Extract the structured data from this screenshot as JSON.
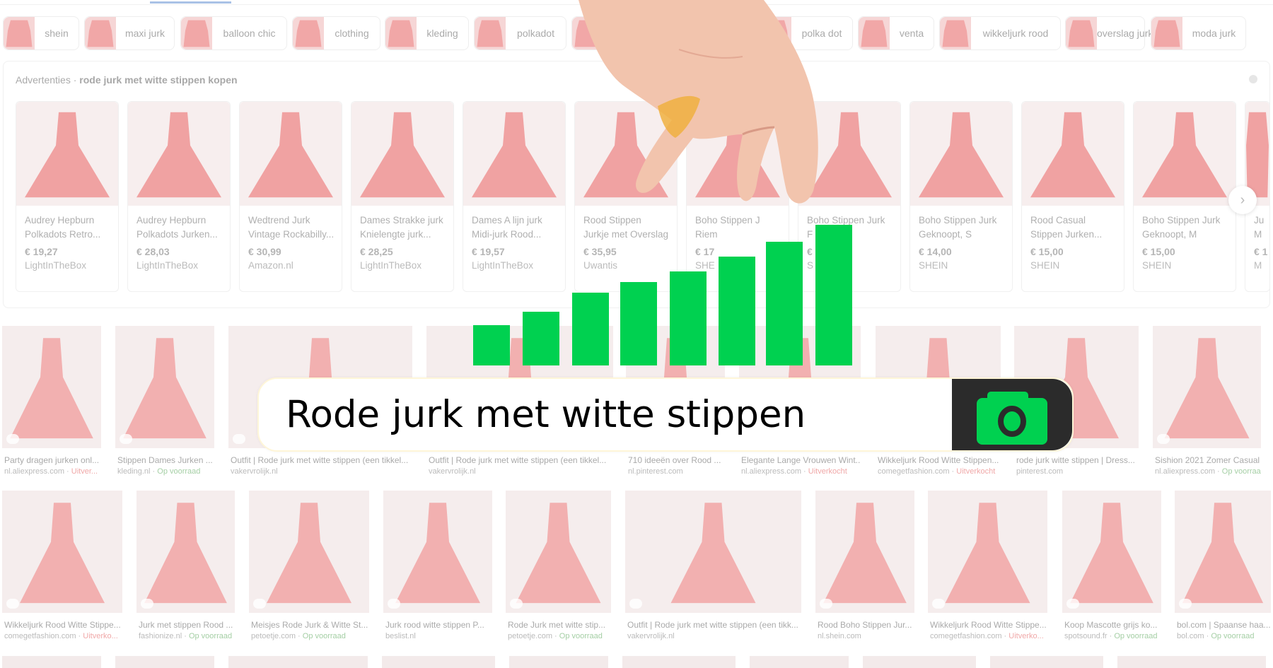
{
  "chips": [
    {
      "label": "shein"
    },
    {
      "label": "maxi jurk"
    },
    {
      "label": "balloon chic"
    },
    {
      "label": "clothing"
    },
    {
      "label": "kleding"
    },
    {
      "label": "polkadot"
    },
    {
      "label": ""
    },
    {
      "label": "polka dot"
    },
    {
      "label": "venta"
    },
    {
      "label": "wikkeljurk rood"
    },
    {
      "label": "overslag jurk"
    },
    {
      "label": "moda jurk"
    }
  ],
  "ads": {
    "label": "Advertenties",
    "separator": " · ",
    "query": "rode jurk met witte stippen kopen",
    "next_icon": "›",
    "items": [
      {
        "title1": "Audrey Hepburn",
        "title2": "Polkadots Retro...",
        "price": "€ 19,27",
        "store": "LightInTheBox"
      },
      {
        "title1": "Audrey Hepburn",
        "title2": "Polkadots Jurken...",
        "price": "€ 28,03",
        "store": "LightInTheBox"
      },
      {
        "title1": "Wedtrend Jurk",
        "title2": "Vintage Rockabilly...",
        "price": "€ 30,99",
        "store": "Amazon.nl"
      },
      {
        "title1": "Dames Strakke jurk",
        "title2": "Knielengte jurk...",
        "price": "€ 28,25",
        "store": "LightInTheBox"
      },
      {
        "title1": "Dames A lijn jurk",
        "title2": "Midi-jurk Rood...",
        "price": "€ 19,57",
        "store": "LightInTheBox"
      },
      {
        "title1": "Rood Stippen",
        "title2": "Jurkje met Overslag",
        "price": "€ 35,95",
        "store": "Uwantis"
      },
      {
        "title1": "Boho Stippen J",
        "title2": "Riem",
        "price": "€ 17",
        "store": "SHE"
      },
      {
        "title1": "Boho Stippen Jurk",
        "title2": "F",
        "price": "€",
        "store": "S"
      },
      {
        "title1": "Boho Stippen Jurk",
        "title2": "Geknoopt, S",
        "price": "€ 14,00",
        "store": "SHEIN"
      },
      {
        "title1": "Rood Casual",
        "title2": "Stippen Jurken...",
        "price": "€ 15,00",
        "store": "SHEIN"
      },
      {
        "title1": "Boho Stippen Jurk",
        "title2": "Geknoopt, M",
        "price": "€ 15,00",
        "store": "SHEIN"
      },
      {
        "title1": "Ju",
        "title2": "M",
        "price": "€ 1",
        "store": "M"
      }
    ]
  },
  "results": {
    "row1": [
      {
        "title": "Party dragen jurken onl...",
        "source": "nl.aliexpress.com",
        "status": "Uitver...",
        "status_type": "sold"
      },
      {
        "title": "Stippen Dames Jurken ...",
        "source": "kleding.nl",
        "status": "Op voorraad",
        "status_type": "stock"
      },
      {
        "title": "Outfit | Rode jurk met witte stippen (een tikkel...",
        "source": "vakervrolijk.nl",
        "status": "",
        "status_type": ""
      },
      {
        "title": "Outfit | Rode jurk met witte stippen (een tikkel...",
        "source": "vakervrolijk.nl",
        "status": "",
        "status_type": ""
      },
      {
        "title": "710 ideeën over Rood ...",
        "source": "nl.pinterest.com",
        "status": "",
        "status_type": ""
      },
      {
        "title": "Elegante Lange Vrouwen Wint...",
        "source": "nl.aliexpress.com",
        "status": "Uitverkocht",
        "status_type": "sold"
      },
      {
        "title": "Wikkeljurk Rood Witte Stippen...",
        "source": "comegetfashion.com",
        "status": "Uitverkocht",
        "status_type": "sold"
      },
      {
        "title": "rode jurk witte stippen | Dress...",
        "source": "pinterest.com",
        "status": "",
        "status_type": ""
      },
      {
        "title": "Sishion 2021 Zomer Casual ...",
        "source": "nl.aliexpress.com",
        "status": "Op voorraad",
        "status_type": "stock"
      }
    ],
    "row2": [
      {
        "title": "Wikkeljurk Rood Witte Stippe...",
        "source": "comegetfashion.com",
        "status": "Uitverko...",
        "status_type": "sold"
      },
      {
        "title": "Jurk met stippen Rood ...",
        "source": "fashionize.nl",
        "status": "Op voorraad",
        "status_type": "stock"
      },
      {
        "title": "Meisjes Rode Jurk & Witte St...",
        "source": "petoetje.com",
        "status": "Op voorraad",
        "status_type": "stock"
      },
      {
        "title": "Jurk rood witte stippen P...",
        "source": "beslist.nl",
        "status": "",
        "status_type": ""
      },
      {
        "title": "Rode Jurk met witte stip...",
        "source": "petoetje.com",
        "status": "Op voorraad",
        "status_type": "stock"
      },
      {
        "title": "Outfit | Rode jurk met witte stippen (een tikk...",
        "source": "vakervrolijk.nl",
        "status": "",
        "status_type": ""
      },
      {
        "title": "Rood Boho Stippen Jur...",
        "source": "nl.shein.com",
        "status": "",
        "status_type": ""
      },
      {
        "title": "Wikkeljurk Rood Witte Stippe...",
        "source": "comegetfashion.com",
        "status": "Uitverko...",
        "status_type": "sold"
      },
      {
        "title": "Koop Mascotte grijs ko...",
        "source": "spotsound.fr",
        "status": "Op voorraad",
        "status_type": "stock"
      },
      {
        "title": "bol.com | Spaanse haa...",
        "source": "bol.com",
        "status": "Op voorraad",
        "status_type": "stock"
      }
    ]
  },
  "overlay": {
    "search_value": "Rode jurk met witte stippen",
    "camera_icon": "camera-icon",
    "bar_levels": [
      1,
      1.34,
      1.8,
      2.07,
      2.34,
      2.7,
      3.07,
      3.5
    ],
    "colors": {
      "bars": "#00d150",
      "camera_bg": "#2b2b2b",
      "camera_icon": "#00d150",
      "sold": "#f0a8a8",
      "stock": "#a5cfa5"
    }
  }
}
